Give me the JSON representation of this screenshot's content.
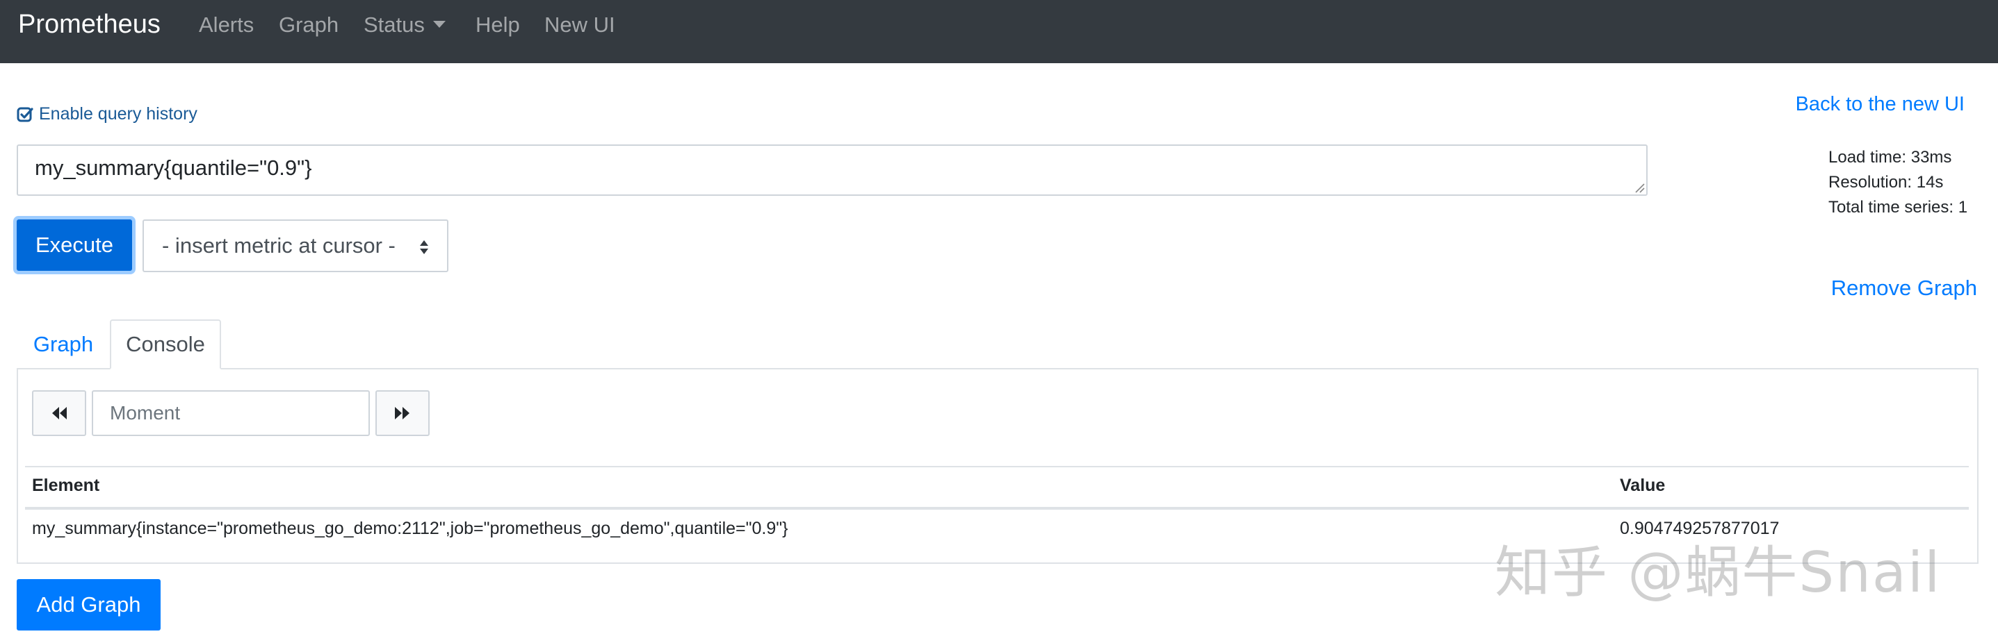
{
  "navbar": {
    "brand": "Prometheus",
    "items": [
      "Alerts",
      "Graph",
      "Status",
      "Help",
      "New UI"
    ]
  },
  "query_history": {
    "label": "Enable query history",
    "checked": true
  },
  "back_link": "Back to the new UI",
  "query": {
    "value": "my_summary{quantile=\"0.9\"}"
  },
  "stats": {
    "load_time": "Load time: 33ms",
    "resolution": "Resolution: 14s",
    "total_series": "Total time series: 1"
  },
  "execute_label": "Execute",
  "metric_select": {
    "selected": "- insert metric at cursor -"
  },
  "remove_graph": "Remove Graph",
  "tabs": {
    "graph": "Graph",
    "console": "Console",
    "active": "Console"
  },
  "moment": {
    "placeholder": "Moment",
    "value": ""
  },
  "table": {
    "headers": [
      "Element",
      "Value"
    ],
    "rows": [
      {
        "element": "my_summary{instance=\"prometheus_go_demo:2112\",job=\"prometheus_go_demo\",quantile=\"0.9\"}",
        "value": "0.904749257877017"
      }
    ]
  },
  "add_graph": "Add Graph",
  "watermark": "知乎 @蜗牛Snail",
  "colors": {
    "navbar_bg": "#343a40",
    "primary": "#007bff",
    "link": "#007bff"
  },
  "icons": {
    "history_checkbox": "check-square-icon",
    "back": "backward-icon",
    "forward": "forward-icon",
    "select_arrows": "sort-icon"
  }
}
